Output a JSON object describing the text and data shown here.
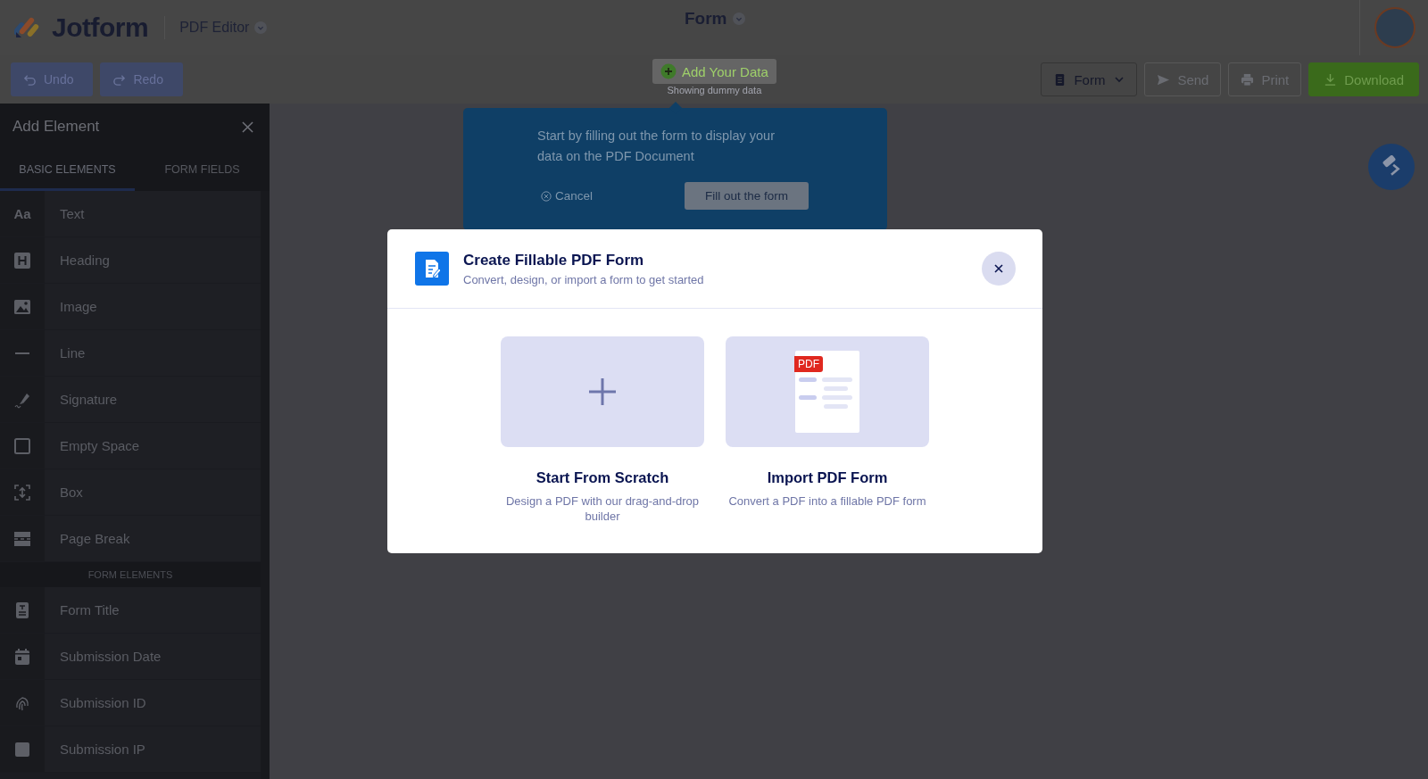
{
  "header": {
    "logo": "Jotform",
    "product": "PDF Editor",
    "document_title": "Form"
  },
  "toolbar": {
    "undo": "Undo",
    "redo": "Redo",
    "add_data": "Add Your Data",
    "add_data_note": "Showing dummy data",
    "form_menu": "Form",
    "send": "Send",
    "print": "Print",
    "download": "Download"
  },
  "sidebar": {
    "title": "Add Element",
    "tabs": [
      {
        "label": "BASIC ELEMENTS",
        "selected": true
      },
      {
        "label": "FORM FIELDS",
        "selected": false
      }
    ],
    "items": [
      {
        "label": "Text",
        "glyph": "Aa"
      },
      {
        "label": "Heading"
      },
      {
        "label": "Image"
      },
      {
        "label": "Line"
      },
      {
        "label": "Signature"
      },
      {
        "label": "Empty Space"
      },
      {
        "label": "Box"
      },
      {
        "label": "Page Break"
      }
    ],
    "section": "FORM ELEMENTS",
    "form_items": [
      {
        "label": "Form Title"
      },
      {
        "label": "Submission Date"
      },
      {
        "label": "Submission ID"
      },
      {
        "label": "Submission IP"
      }
    ]
  },
  "popover": {
    "text": "Start by filling out the form to display your data on the PDF Document",
    "cancel": "Cancel",
    "fill": "Fill out the form"
  },
  "modal": {
    "title": "Create Fillable PDF Form",
    "subtitle": "Convert, design, or import a form to get started",
    "options": [
      {
        "kind": "blank",
        "title": "Start From Scratch",
        "description": "Design a PDF with our drag-and-drop builder"
      },
      {
        "kind": "import",
        "title": "Import PDF Form",
        "description": "Convert a PDF into a fillable PDF form",
        "badge": "PDF"
      }
    ]
  }
}
